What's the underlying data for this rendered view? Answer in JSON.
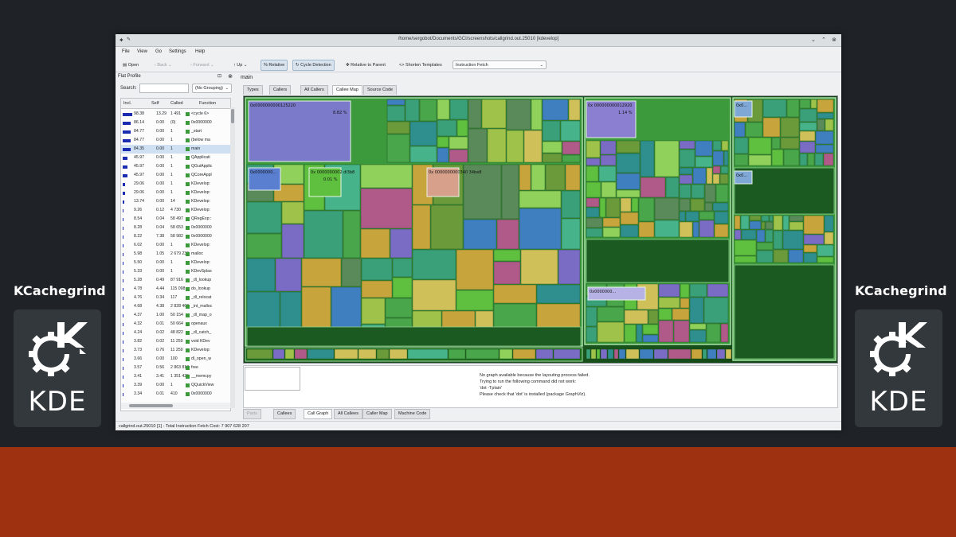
{
  "brand": {
    "left_title": "KCachegrind",
    "right_title": "KCachegrind",
    "logo_text": "KDE"
  },
  "window": {
    "title": "/home/sergobot/Documents/GCI/screenshots/callgrind.out.25010 [kdevelop]"
  },
  "menu": [
    "File",
    "View",
    "Go",
    "Settings",
    "Help"
  ],
  "toolbar": {
    "open": "Open",
    "back": "Back",
    "forward": "Forward",
    "up": "Up",
    "relative": "Relative",
    "cycle_detection": "Cycle Detection",
    "relative_to_parent": "Relative to Parent",
    "shorten_templates": "Shorten Templates",
    "event_type": "Instruction Fetch"
  },
  "flat_profile": {
    "title": "Flat Profile",
    "search_label": "Search:",
    "grouping": "(No Grouping)",
    "columns": [
      "Incl.",
      "Self",
      "Called",
      "Function"
    ],
    "rows": [
      {
        "incl": "98.38",
        "self": "13.29",
        "called": "1 491",
        "fn": "<cycle 6>"
      },
      {
        "incl": "86.14",
        "self": "0.00",
        "called": "(0)",
        "fn": "0x0000000"
      },
      {
        "incl": "84.77",
        "self": "0.00",
        "called": "1",
        "fn": "_start"
      },
      {
        "incl": "84.77",
        "self": "0.00",
        "called": "1",
        "fn": "(below ma"
      },
      {
        "incl": "84.35",
        "self": "0.00",
        "called": "1",
        "fn": "main"
      },
      {
        "incl": "45.97",
        "self": "0.00",
        "called": "1",
        "fn": "QApplicati"
      },
      {
        "incl": "45.97",
        "self": "0.00",
        "called": "1",
        "fn": "QGuiApplic"
      },
      {
        "incl": "45.97",
        "self": "0.00",
        "called": "1",
        "fn": "QCoreAppl"
      },
      {
        "incl": "29.06",
        "self": "0.00",
        "called": "1",
        "fn": "KDevelop:"
      },
      {
        "incl": "29.06",
        "self": "0.00",
        "called": "1",
        "fn": "KDevelop:"
      },
      {
        "incl": "13.74",
        "self": "0.00",
        "called": "14",
        "fn": "KDevelop:"
      },
      {
        "incl": "9.26",
        "self": "0.12",
        "called": "4 730",
        "fn": "KDevelop:"
      },
      {
        "incl": "8.54",
        "self": "0.04",
        "called": "58 497",
        "fn": "QRegExp::"
      },
      {
        "incl": "8.28",
        "self": "0.04",
        "called": "58 653",
        "fn": "0x0000000"
      },
      {
        "incl": "8.22",
        "self": "7.38",
        "called": "58 982",
        "fn": "0x0000000"
      },
      {
        "incl": "6.02",
        "self": "0.00",
        "called": "1",
        "fn": "KDevelop:"
      },
      {
        "incl": "5.98",
        "self": "1.05",
        "called": "2 679 230",
        "fn": "malloc"
      },
      {
        "incl": "5.50",
        "self": "0.00",
        "called": "1",
        "fn": "KDevelop:"
      },
      {
        "incl": "5.33",
        "self": "0.00",
        "called": "1",
        "fn": "KDevSplas"
      },
      {
        "incl": "5.28",
        "self": "0.49",
        "called": "87 916",
        "fn": "_dl_lookup"
      },
      {
        "incl": "4.78",
        "self": "4.44",
        "called": "115 098",
        "fn": "do_lookup"
      },
      {
        "incl": "4.76",
        "self": "0.34",
        "called": "117",
        "fn": "_dl_relocat"
      },
      {
        "incl": "4.68",
        "self": "4.38",
        "called": "2 828 460",
        "fn": "_int_malloc"
      },
      {
        "incl": "4.37",
        "self": "1.00",
        "called": "50 154",
        "fn": "_dl_map_o"
      },
      {
        "incl": "4.32",
        "self": "0.01",
        "called": "50 664",
        "fn": "openaux"
      },
      {
        "incl": "4.24",
        "self": "0.02",
        "called": "48 822",
        "fn": "_dl_catch_"
      },
      {
        "incl": "3.82",
        "self": "0.02",
        "called": "11 259",
        "fn": "void KDev"
      },
      {
        "incl": "3.73",
        "self": "0.76",
        "called": "11 259",
        "fn": "KDevelop:"
      },
      {
        "incl": "3.66",
        "self": "0.00",
        "called": "100",
        "fn": "dl_open_w"
      },
      {
        "incl": "3.57",
        "self": "0.56",
        "called": "2 863 813",
        "fn": "free"
      },
      {
        "incl": "3.41",
        "self": "3.41",
        "called": "1 351 425",
        "fn": "__memcpy"
      },
      {
        "incl": "3.39",
        "self": "0.00",
        "called": "1",
        "fn": "QQuickView"
      },
      {
        "incl": "3.34",
        "self": "0.01",
        "called": "410",
        "fn": "0x0000000"
      }
    ],
    "incl_bars": [
      98.38,
      86.14,
      84.77,
      84.77,
      84.35,
      45.97,
      45.97,
      45.97,
      29.06,
      29.06,
      13.74,
      9.26,
      8.54,
      8.28,
      8.22,
      6.02,
      5.98,
      5.5,
      5.33,
      5.28,
      4.78,
      4.76,
      4.68,
      4.37,
      4.32,
      4.24,
      3.82,
      3.73,
      3.66,
      3.57,
      3.41,
      3.39,
      3.34
    ],
    "selected_function": "main"
  },
  "main": {
    "title": "main",
    "top_tabs": [
      "Types",
      "Callers",
      "All Callers",
      "Callee Map",
      "Source Code"
    ],
    "top_active": "Callee Map",
    "treemap_labels": {
      "box1": "0x0000000000125220",
      "box1_pct": "8.82 %",
      "box2": "0x 000000000012920",
      "box2_pct": "1.14 %",
      "box3": "0x 0000000002 dl3b8",
      "box3_pct": "0.01 %",
      "box4": "0x 0000000000340 34be8",
      "box5": "0x0000000...",
      "box6": "0x0000000...",
      "box7": "0x0...",
      "box8": "0x0..."
    },
    "callgraph_message": [
      "No graph available because the layouting process failed.",
      "Trying to run the following command did not work:",
      "'dot -Tplain'",
      "Please check that 'dot' is installed (package GraphViz)."
    ],
    "bottom_tabs": [
      "Parts",
      "Callees",
      "Call Graph",
      "All Callees",
      "Caller Map",
      "Machine Code"
    ],
    "bottom_active": "Call Graph"
  },
  "status": "callgrind.out.25010 [1] - Total Instruction Fetch Cost: 7 907 628 207",
  "colors": {
    "background": "#1f2327",
    "band": "#9e3210",
    "tile": "#33383d",
    "treemap_base": "#2a8a2a",
    "bar": "#1c2cb0"
  }
}
